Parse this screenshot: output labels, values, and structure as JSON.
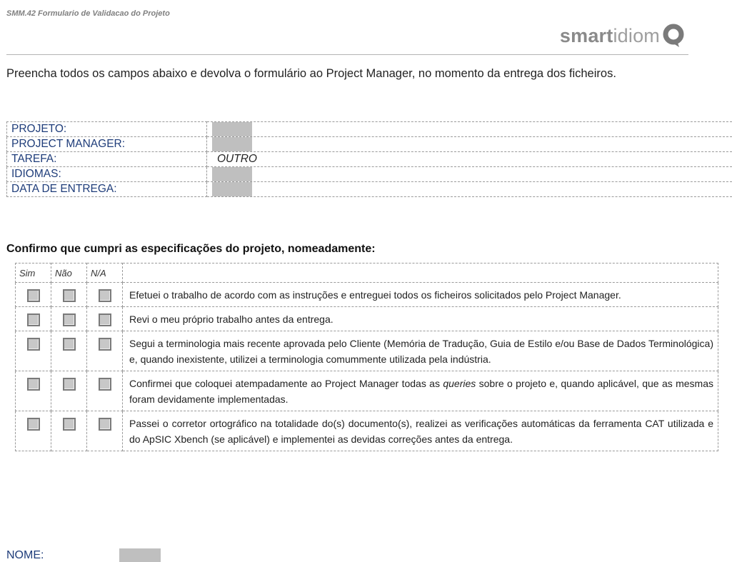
{
  "header": {
    "doc_code": "SMM.42 Formulario de Validacao do Projeto",
    "logo_text": "smartidiom"
  },
  "intro": "Preencha todos os campos abaixo e devolva o formulário ao Project Manager, no momento da entrega dos ficheiros.",
  "info": {
    "rows": [
      {
        "label": "PROJETO:",
        "value": ""
      },
      {
        "label": "PROJECT MANAGER:",
        "value": ""
      },
      {
        "label": "TAREFA:",
        "value": "OUTRO"
      },
      {
        "label": "IDIOMAS:",
        "value": ""
      },
      {
        "label": "DATA DE ENTREGA:",
        "value": ""
      }
    ]
  },
  "confirm": {
    "heading": "Confirmo que cumpri as especificações do projeto, nomeadamente:",
    "columns": [
      "Sim",
      "Não",
      "N/A"
    ],
    "items": [
      "Efetuei o trabalho de acordo com as instruções e entreguei todos os ficheiros solicitados pelo Project Manager.",
      "Revi o meu próprio trabalho antes da entrega.",
      "Segui a terminologia mais recente aprovada pelo Cliente (Memória de Tradução, Guia de Estilo e/ou Base de Dados Terminológica) e, quando inexistente, utilizei a terminologia comummente utilizada pela indústria.",
      "Confirmei que coloquei atempadamente ao Project Manager todas as queries sobre o projeto e, quando aplicável, que as mesmas foram devidamente implementadas.",
      "Passei o corretor ortográfico na totalidade do(s) documento(s), realizei as verificações automáticas da ferramenta CAT utilizada e do ApSIC Xbench (se aplicável) e implementei as devidas correções antes da entrega."
    ]
  },
  "footer": {
    "name_label": "NOME:"
  }
}
